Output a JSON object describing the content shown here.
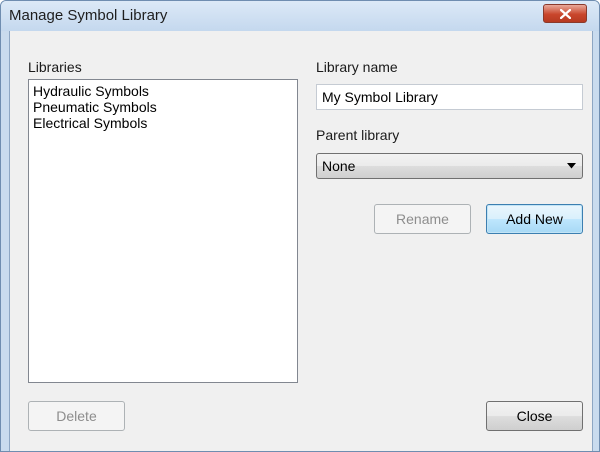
{
  "window": {
    "title": "Manage Symbol Library"
  },
  "libraries": {
    "label": "Libraries",
    "items": [
      "Hydraulic Symbols",
      "Pneumatic Symbols",
      "Electrical Symbols"
    ]
  },
  "library_name": {
    "label": "Library name",
    "value": "My Symbol Library"
  },
  "parent_library": {
    "label": "Parent library",
    "selected": "None"
  },
  "buttons": {
    "rename": "Rename",
    "add_new": "Add New",
    "delete": "Delete",
    "close": "Close"
  },
  "colors": {
    "close_button": "#c9462c",
    "focus_border": "#3c7fb1"
  },
  "icons": {
    "window_close": "close-icon",
    "dropdown": "chevron-down-icon"
  }
}
